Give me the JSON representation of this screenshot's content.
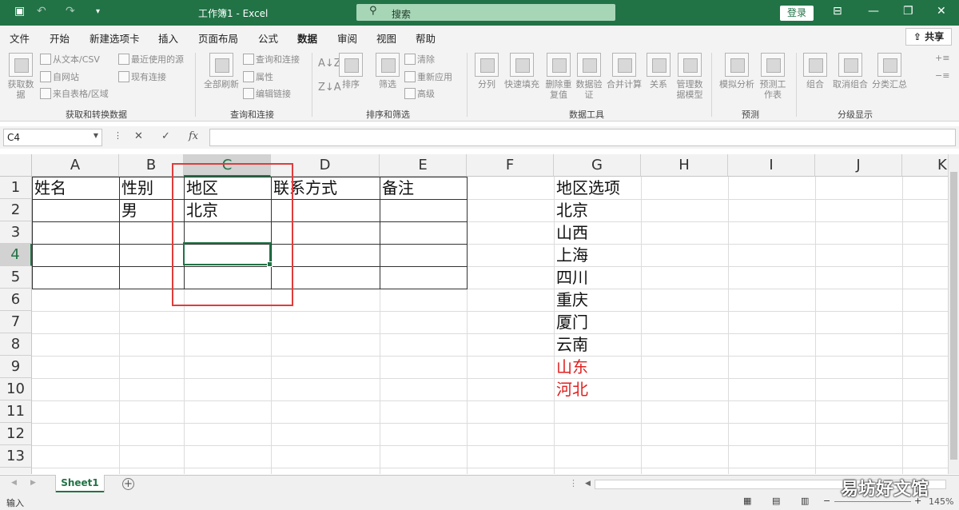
{
  "titlebar": {
    "title": "工作簿1 - Excel",
    "search": "搜索",
    "login": "登录"
  },
  "tabs": [
    "文件",
    "开始",
    "新建选项卡",
    "插入",
    "页面布局",
    "公式",
    "数据",
    "审阅",
    "视图",
    "帮助"
  ],
  "share": "共享",
  "ribbon": {
    "get_data": "获取数据",
    "from_text": "从文本/CSV",
    "from_web": "自网站",
    "from_table": "来自表格/区域",
    "recent_sources": "最近使用的源",
    "existing_conn": "现有连接",
    "refresh_all": "全部刷新",
    "queries_conn": "查询和连接",
    "properties": "属性",
    "edit_links": "编辑链接",
    "sort": "排序",
    "filter": "筛选",
    "clear": "清除",
    "reapply": "重新应用",
    "advanced": "高级",
    "text_to_col": "分列",
    "flash_fill": "快速填充",
    "remove_dup": "删除重复值",
    "data_valid": "数据验证",
    "consolidate": "合并计算",
    "relations": "关系",
    "data_model": "管理数据模型",
    "whatif": "模拟分析",
    "forecast": "预测工作表",
    "group": "组合",
    "ungroup": "取消组合",
    "subtotal": "分类汇总",
    "groups": [
      "获取和转换数据",
      "查询和连接",
      "排序和筛选",
      "数据工具",
      "预测",
      "分级显示"
    ]
  },
  "namebox": "C4",
  "columns": [
    "A",
    "B",
    "C",
    "D",
    "E",
    "F",
    "G",
    "H",
    "I",
    "J",
    "K"
  ],
  "rows": [
    "1",
    "2",
    "3",
    "4",
    "5",
    "6",
    "7",
    "8",
    "9",
    "10",
    "11",
    "12",
    "13"
  ],
  "table": {
    "headers": [
      "姓名",
      "性别",
      "地区",
      "联系方式",
      "备注"
    ],
    "row2": {
      "b": "男",
      "c": "北京"
    }
  },
  "region_title": "地区选项",
  "regions": [
    {
      "name": "北京",
      "color": "#111111"
    },
    {
      "name": "山西",
      "color": "#111111"
    },
    {
      "name": "上海",
      "color": "#111111"
    },
    {
      "name": "四川",
      "color": "#111111"
    },
    {
      "name": "重庆",
      "color": "#111111"
    },
    {
      "name": "厦门",
      "color": "#111111"
    },
    {
      "name": "云南",
      "color": "#111111"
    },
    {
      "name": "山东",
      "color": "#e02020"
    },
    {
      "name": "河北",
      "color": "#e02020"
    }
  ],
  "sheet": "Sheet1",
  "status": {
    "mode": "输入",
    "zoom": "145%"
  },
  "watermark": "易坊好文馆"
}
